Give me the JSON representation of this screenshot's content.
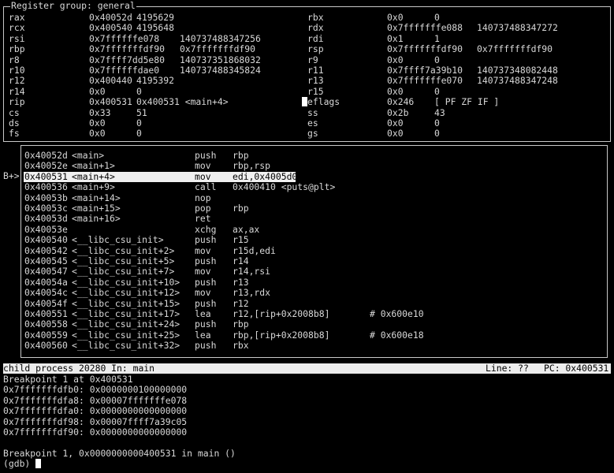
{
  "registers": {
    "title": "Register group: general",
    "left": [
      {
        "name": "rax",
        "hex": "0x40052d",
        "val": "4195629"
      },
      {
        "name": "rcx",
        "hex": "0x400540",
        "val": "4195648"
      },
      {
        "name": "rsi",
        "hex": "0x7ffffffe078",
        "val": "140737488347256"
      },
      {
        "name": "rbp",
        "hex": "0x7fffffffdf90",
        "val": "0x7fffffffdf90"
      },
      {
        "name": "r8",
        "hex": "0x7ffff7dd5e80",
        "val": "140737351868032"
      },
      {
        "name": "r10",
        "hex": "0x7ffffffdae0",
        "val": "140737488345824"
      },
      {
        "name": "r12",
        "hex": "0x400440",
        "val": "4195392"
      },
      {
        "name": "r14",
        "hex": "0x0",
        "val": "0"
      },
      {
        "name": "rip",
        "hex": "0x400531",
        "val": "0x400531 <main+4>"
      },
      {
        "name": "cs",
        "hex": "0x33",
        "val": "51"
      },
      {
        "name": "ds",
        "hex": "0x0",
        "val": "0"
      },
      {
        "name": "fs",
        "hex": "0x0",
        "val": "0"
      }
    ],
    "right": [
      {
        "name": "rbx",
        "hex": "0x0",
        "val": "0"
      },
      {
        "name": "rdx",
        "hex": "0x7fffffffe088",
        "val": "140737488347272"
      },
      {
        "name": "rdi",
        "hex": "0x1",
        "val": "1"
      },
      {
        "name": "rsp",
        "hex": "0x7fffffffdf90",
        "val": "0x7fffffffdf90"
      },
      {
        "name": "r9",
        "hex": "0x0",
        "val": "0"
      },
      {
        "name": "r11",
        "hex": "0x7ffff7a39b10",
        "val": "140737348082448"
      },
      {
        "name": "r13",
        "hex": "0x7fffffffe070",
        "val": "140737488347248"
      },
      {
        "name": "r15",
        "hex": "0x0",
        "val": "0"
      },
      {
        "name": "eflags",
        "hex": "0x246",
        "val": "[ PF ZF IF ]"
      },
      {
        "name": "ss",
        "hex": "0x2b",
        "val": "43"
      },
      {
        "name": "es",
        "hex": "0x0",
        "val": "0"
      },
      {
        "name": "gs",
        "hex": "0x0",
        "val": "0"
      }
    ]
  },
  "asm": {
    "marker": "B+>",
    "rows": [
      {
        "addr": "0x40052d",
        "sym": "<main>",
        "op": "push",
        "args": "rbp",
        "cmt": ""
      },
      {
        "addr": "0x40052e",
        "sym": "<main+1>",
        "op": "mov",
        "args": "rbp,rsp",
        "cmt": ""
      },
      {
        "addr": "0x400531",
        "sym": "<main+4>",
        "op": "mov",
        "args": "edi,0x4005d0",
        "cmt": ""
      },
      {
        "addr": "0x400536",
        "sym": "<main+9>",
        "op": "call",
        "args": "0x400410 <puts@plt>",
        "cmt": ""
      },
      {
        "addr": "0x40053b",
        "sym": "<main+14>",
        "op": "nop",
        "args": "",
        "cmt": ""
      },
      {
        "addr": "0x40053c",
        "sym": "<main+15>",
        "op": "pop",
        "args": "rbp",
        "cmt": ""
      },
      {
        "addr": "0x40053d",
        "sym": "<main+16>",
        "op": "ret",
        "args": "",
        "cmt": ""
      },
      {
        "addr": "0x40053e",
        "sym": "",
        "op": "xchg",
        "args": "ax,ax",
        "cmt": ""
      },
      {
        "addr": "0x400540",
        "sym": "<__libc_csu_init>",
        "op": "push",
        "args": "r15",
        "cmt": ""
      },
      {
        "addr": "0x400542",
        "sym": "<__libc_csu_init+2>",
        "op": "mov",
        "args": "r15d,edi",
        "cmt": ""
      },
      {
        "addr": "0x400545",
        "sym": "<__libc_csu_init+5>",
        "op": "push",
        "args": "r14",
        "cmt": ""
      },
      {
        "addr": "0x400547",
        "sym": "<__libc_csu_init+7>",
        "op": "mov",
        "args": "r14,rsi",
        "cmt": ""
      },
      {
        "addr": "0x40054a",
        "sym": "<__libc_csu_init+10>",
        "op": "push",
        "args": "r13",
        "cmt": ""
      },
      {
        "addr": "0x40054c",
        "sym": "<__libc_csu_init+12>",
        "op": "mov",
        "args": "r13,rdx",
        "cmt": ""
      },
      {
        "addr": "0x40054f",
        "sym": "<__libc_csu_init+15>",
        "op": "push",
        "args": "r12",
        "cmt": ""
      },
      {
        "addr": "0x400551",
        "sym": "<__libc_csu_init+17>",
        "op": "lea",
        "args": "r12,[rip+0x2008b8]",
        "cmt": "# 0x600e10"
      },
      {
        "addr": "0x400558",
        "sym": "<__libc_csu_init+24>",
        "op": "push",
        "args": "rbp",
        "cmt": ""
      },
      {
        "addr": "0x400559",
        "sym": "<__libc_csu_init+25>",
        "op": "lea",
        "args": "rbp,[rip+0x2008b8]",
        "cmt": "# 0x600e18"
      },
      {
        "addr": "0x400560",
        "sym": "<__libc_csu_init+32>",
        "op": "push",
        "args": "rbx",
        "cmt": ""
      }
    ]
  },
  "status": {
    "left": "child process 20280 In: main",
    "line": "Line: ??",
    "pc": "PC: 0x400531"
  },
  "console": {
    "lines": [
      "Breakpoint 1 at 0x400531",
      "0x7fffffffdfb0: 0x0000000100000000",
      "0x7fffffffdfa8: 0x00007fffffffe078",
      "0x7fffffffdfa0: 0x0000000000000000",
      "0x7fffffffdf98: 0x00007ffff7a39c05",
      "0x7fffffffdf90: 0x0000000000000000",
      "",
      "Breakpoint 1, 0x0000000000400531 in main ()"
    ],
    "prompt": "(gdb) "
  }
}
